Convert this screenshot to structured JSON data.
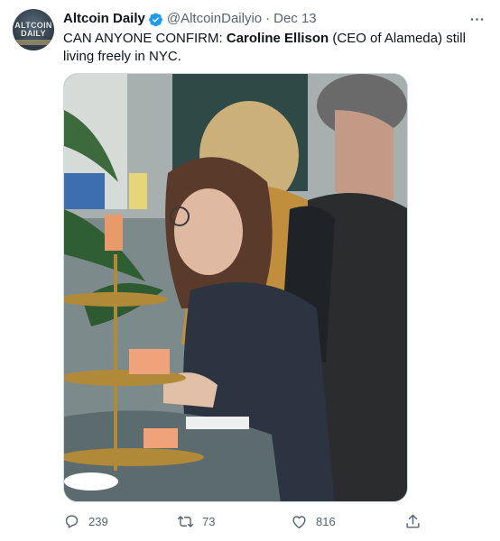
{
  "author": {
    "name": "Altcoin Daily",
    "handle": "@AltcoinDailyio",
    "date": "Dec 13",
    "verified": true,
    "avatar_logo_line1": "ALTCOIN",
    "avatar_logo_line2": "DAILY"
  },
  "tweet": {
    "text_part1": "CAN ANYONE CONFIRM: ",
    "text_bold": "Caroline Ellison",
    "text_part2": " (CEO of Alameda) still living freely in NYC."
  },
  "metrics": {
    "replies": "239",
    "retweets": "73",
    "likes": "816"
  },
  "icons": {
    "more": "more-horizontal-icon",
    "reply": "reply-icon",
    "retweet": "retweet-icon",
    "like": "heart-icon",
    "share": "share-icon",
    "verified": "verified-badge-icon"
  },
  "colors": {
    "verified": "#1d9bf0",
    "secondary_text": "#536471",
    "primary_text": "#0f1419"
  }
}
